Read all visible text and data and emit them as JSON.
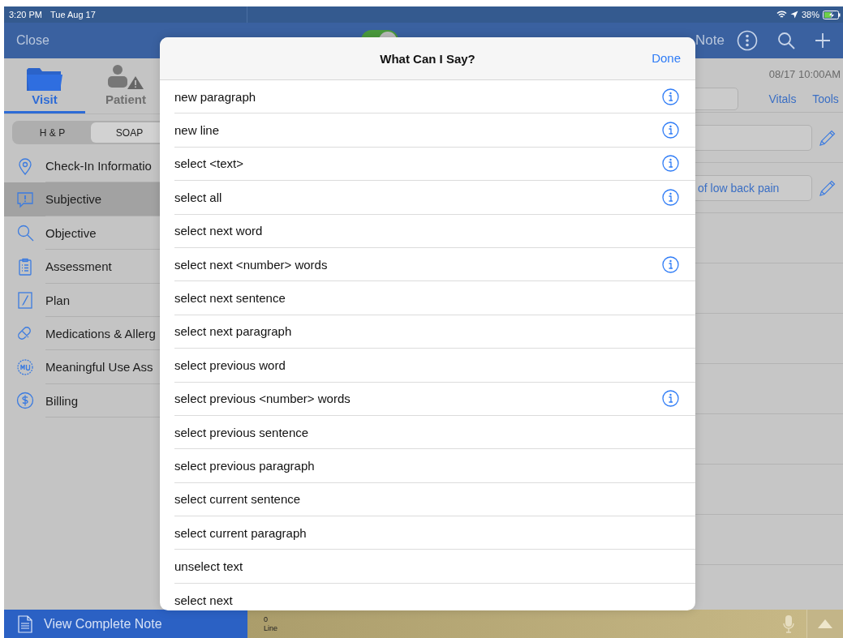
{
  "status_bar": {
    "time": "3:20 PM",
    "date": "Tue Aug 17",
    "battery": "38%"
  },
  "header": {
    "close": "Close",
    "toggle": {
      "on": true
    },
    "title_fragment": "Note"
  },
  "tabs": [
    {
      "label": "Visit",
      "kind": "folder",
      "selected": true
    },
    {
      "label": "Patient",
      "kind": "patient",
      "selected": false
    }
  ],
  "segments": [
    {
      "label": "H & P",
      "selected": false
    },
    {
      "label": "SOAP",
      "selected": true
    }
  ],
  "nav": [
    {
      "label": "Check-In Informatio",
      "kind": "pin",
      "selected": false
    },
    {
      "label": "Subjective",
      "kind": "speech",
      "selected": true
    },
    {
      "label": "Objective",
      "kind": "search",
      "selected": false
    },
    {
      "label": "Assessment",
      "kind": "clipboard",
      "selected": false
    },
    {
      "label": "Plan",
      "kind": "pen",
      "selected": false
    },
    {
      "label": "Medications & Allerg",
      "kind": "pill",
      "selected": false
    },
    {
      "label": "Meaningful Use Ass",
      "kind": "badge",
      "selected": false
    },
    {
      "label": "Billing",
      "kind": "dollar",
      "selected": false
    }
  ],
  "visit": {
    "datetime": "08/17 10:00AM",
    "links": [
      "Vitals",
      "Tools"
    ],
    "fields": [
      {
        "kind": "blank"
      },
      {
        "kind": "filled",
        "value": "of low back pain"
      }
    ]
  },
  "modal": {
    "title": "What Can I Say?",
    "done": "Done",
    "commands": [
      {
        "text": "new paragraph",
        "info": true
      },
      {
        "text": "new line",
        "info": true
      },
      {
        "text": "select <text>",
        "info": true
      },
      {
        "text": "select all",
        "info": true
      },
      {
        "text": "select next word",
        "info": false
      },
      {
        "text": "select next <number> words",
        "info": true
      },
      {
        "text": "select next sentence",
        "info": false
      },
      {
        "text": "select next paragraph",
        "info": false
      },
      {
        "text": "select previous word",
        "info": false
      },
      {
        "text": "select previous <number> words",
        "info": true
      },
      {
        "text": "select previous sentence",
        "info": false
      },
      {
        "text": "select previous paragraph",
        "info": false
      },
      {
        "text": "select current sentence",
        "info": false
      },
      {
        "text": "select current paragraph",
        "info": false
      },
      {
        "text": "unselect text",
        "info": false
      },
      {
        "text": "select next",
        "info": false
      }
    ]
  },
  "footer": {
    "view_note": "View Complete Note",
    "line_count": "0",
    "line_label": "Line"
  }
}
